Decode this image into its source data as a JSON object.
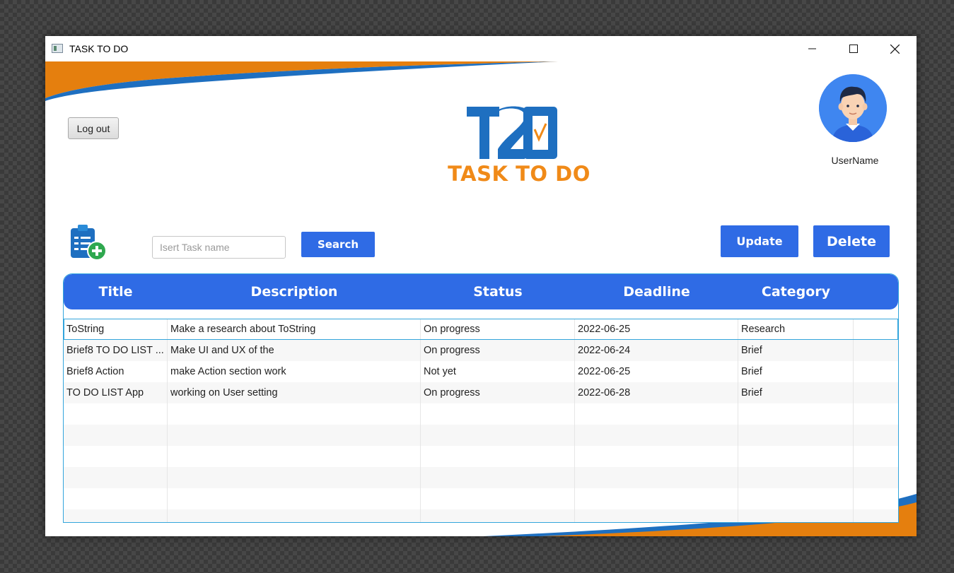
{
  "window": {
    "title": "TASK TO DO"
  },
  "header": {
    "logout_label": "Log out",
    "logo_text": "TASK TO DO",
    "username": "UserName"
  },
  "toolbar": {
    "search_placeholder": "Isert Task name",
    "search_label": "Search",
    "update_label": "Update",
    "delete_label": "Delete"
  },
  "table": {
    "columns": [
      "Title",
      "Description",
      "Status",
      "Deadline",
      "Category"
    ],
    "rows": [
      [
        "ToString",
        "Make a research about ToString",
        "On progress",
        "2022-06-25",
        "Research"
      ],
      [
        "Brief8 TO DO LIST ...",
        "Make UI and UX of the",
        "On progress",
        "2022-06-24",
        "Brief"
      ],
      [
        "Brief8 Action",
        "make Action section work",
        "Not yet",
        "2022-06-25",
        "Brief"
      ],
      [
        "TO DO LIST App",
        "working on User setting",
        "On progress",
        "2022-06-28",
        "Brief"
      ],
      [
        "",
        "",
        "",
        "",
        ""
      ],
      [
        "",
        "",
        "",
        "",
        ""
      ],
      [
        "",
        "",
        "",
        "",
        ""
      ],
      [
        "",
        "",
        "",
        "",
        ""
      ],
      [
        "",
        "",
        "",
        "",
        ""
      ],
      [
        "",
        "",
        "",
        "",
        ""
      ]
    ]
  },
  "colors": {
    "accent_blue": "#2f6be5",
    "accent_orange": "#f08a18",
    "table_border": "#33a5dc"
  }
}
